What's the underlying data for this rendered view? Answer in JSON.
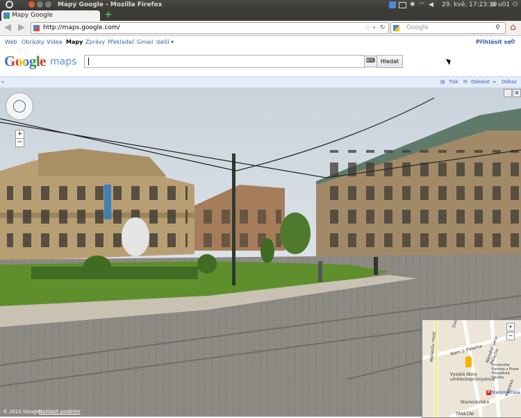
{
  "system_panel": {
    "window_title": "Mapy Google - Mozilla Firefox",
    "datetime": "29. kvě, 17:23:19",
    "user": "u01"
  },
  "browser": {
    "tab_title": "Mapy Google",
    "url": "http://maps.google.com/",
    "search_placeholder": "Google"
  },
  "google_bar": {
    "links": [
      "Web",
      "Obrázky",
      "Videa",
      "Mapy",
      "Zprávy",
      "Překladač",
      "Gmail",
      "další ▾"
    ],
    "active_index": 3,
    "signin": "Přihlásit se"
  },
  "maps": {
    "logo": "Google",
    "logo_suffix": "maps",
    "search_value": "",
    "search_button": "Hledat",
    "toolbar": {
      "print": "Tisk",
      "send": "Odeslat",
      "link": "Odkaz"
    }
  },
  "street_view": {
    "copyright": "© 2011 Google",
    "report": "Nahlásit problém",
    "zoom_in": "+",
    "zoom_out": "−"
  },
  "minimap": {
    "labels": {
      "street1": "Náměstí Jana Palacha",
      "street2": "Nám. J. Palacha",
      "street3": "Mánesův most",
      "school": "Vysoká škola uměleckoprůmyslová",
      "faculty": "Univerzita Karlova v Praze Filozofická fakulta",
      "metro": "Staroměstská",
      "metro2": "Staroměstská",
      "street4": "Dvořákovo",
      "tanecni": "TANEČNÍ",
      "street5": "Kaprova"
    }
  },
  "colors": {
    "link": "#2a5db0",
    "sky": "#dfe6ec",
    "grass": "#5e8f2c",
    "cobble": "#8d8a84"
  }
}
